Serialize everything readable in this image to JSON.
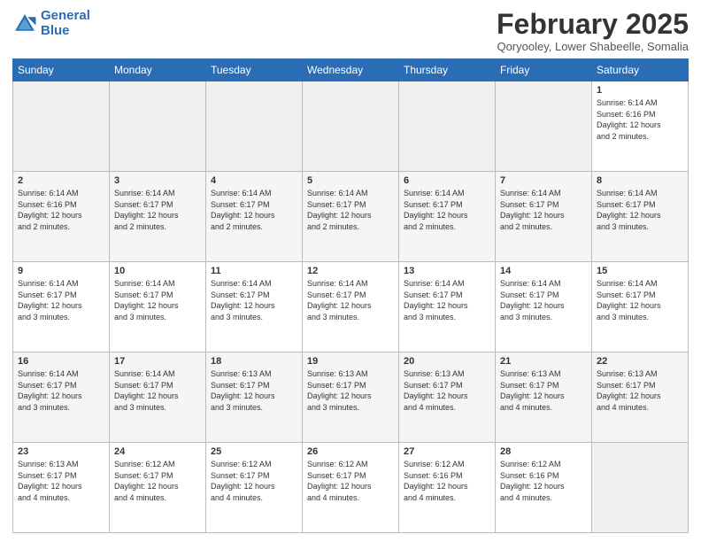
{
  "logo": {
    "line1": "General",
    "line2": "Blue"
  },
  "title": "February 2025",
  "subtitle": "Qoryooley, Lower Shabeelle, Somalia",
  "days_of_week": [
    "Sunday",
    "Monday",
    "Tuesday",
    "Wednesday",
    "Thursday",
    "Friday",
    "Saturday"
  ],
  "weeks": [
    [
      {
        "day": "",
        "info": ""
      },
      {
        "day": "",
        "info": ""
      },
      {
        "day": "",
        "info": ""
      },
      {
        "day": "",
        "info": ""
      },
      {
        "day": "",
        "info": ""
      },
      {
        "day": "",
        "info": ""
      },
      {
        "day": "1",
        "info": "Sunrise: 6:14 AM\nSunset: 6:16 PM\nDaylight: 12 hours\nand 2 minutes."
      }
    ],
    [
      {
        "day": "2",
        "info": "Sunrise: 6:14 AM\nSunset: 6:16 PM\nDaylight: 12 hours\nand 2 minutes."
      },
      {
        "day": "3",
        "info": "Sunrise: 6:14 AM\nSunset: 6:17 PM\nDaylight: 12 hours\nand 2 minutes."
      },
      {
        "day": "4",
        "info": "Sunrise: 6:14 AM\nSunset: 6:17 PM\nDaylight: 12 hours\nand 2 minutes."
      },
      {
        "day": "5",
        "info": "Sunrise: 6:14 AM\nSunset: 6:17 PM\nDaylight: 12 hours\nand 2 minutes."
      },
      {
        "day": "6",
        "info": "Sunrise: 6:14 AM\nSunset: 6:17 PM\nDaylight: 12 hours\nand 2 minutes."
      },
      {
        "day": "7",
        "info": "Sunrise: 6:14 AM\nSunset: 6:17 PM\nDaylight: 12 hours\nand 2 minutes."
      },
      {
        "day": "8",
        "info": "Sunrise: 6:14 AM\nSunset: 6:17 PM\nDaylight: 12 hours\nand 3 minutes."
      }
    ],
    [
      {
        "day": "9",
        "info": "Sunrise: 6:14 AM\nSunset: 6:17 PM\nDaylight: 12 hours\nand 3 minutes."
      },
      {
        "day": "10",
        "info": "Sunrise: 6:14 AM\nSunset: 6:17 PM\nDaylight: 12 hours\nand 3 minutes."
      },
      {
        "day": "11",
        "info": "Sunrise: 6:14 AM\nSunset: 6:17 PM\nDaylight: 12 hours\nand 3 minutes."
      },
      {
        "day": "12",
        "info": "Sunrise: 6:14 AM\nSunset: 6:17 PM\nDaylight: 12 hours\nand 3 minutes."
      },
      {
        "day": "13",
        "info": "Sunrise: 6:14 AM\nSunset: 6:17 PM\nDaylight: 12 hours\nand 3 minutes."
      },
      {
        "day": "14",
        "info": "Sunrise: 6:14 AM\nSunset: 6:17 PM\nDaylight: 12 hours\nand 3 minutes."
      },
      {
        "day": "15",
        "info": "Sunrise: 6:14 AM\nSunset: 6:17 PM\nDaylight: 12 hours\nand 3 minutes."
      }
    ],
    [
      {
        "day": "16",
        "info": "Sunrise: 6:14 AM\nSunset: 6:17 PM\nDaylight: 12 hours\nand 3 minutes."
      },
      {
        "day": "17",
        "info": "Sunrise: 6:14 AM\nSunset: 6:17 PM\nDaylight: 12 hours\nand 3 minutes."
      },
      {
        "day": "18",
        "info": "Sunrise: 6:13 AM\nSunset: 6:17 PM\nDaylight: 12 hours\nand 3 minutes."
      },
      {
        "day": "19",
        "info": "Sunrise: 6:13 AM\nSunset: 6:17 PM\nDaylight: 12 hours\nand 3 minutes."
      },
      {
        "day": "20",
        "info": "Sunrise: 6:13 AM\nSunset: 6:17 PM\nDaylight: 12 hours\nand 4 minutes."
      },
      {
        "day": "21",
        "info": "Sunrise: 6:13 AM\nSunset: 6:17 PM\nDaylight: 12 hours\nand 4 minutes."
      },
      {
        "day": "22",
        "info": "Sunrise: 6:13 AM\nSunset: 6:17 PM\nDaylight: 12 hours\nand 4 minutes."
      }
    ],
    [
      {
        "day": "23",
        "info": "Sunrise: 6:13 AM\nSunset: 6:17 PM\nDaylight: 12 hours\nand 4 minutes."
      },
      {
        "day": "24",
        "info": "Sunrise: 6:12 AM\nSunset: 6:17 PM\nDaylight: 12 hours\nand 4 minutes."
      },
      {
        "day": "25",
        "info": "Sunrise: 6:12 AM\nSunset: 6:17 PM\nDaylight: 12 hours\nand 4 minutes."
      },
      {
        "day": "26",
        "info": "Sunrise: 6:12 AM\nSunset: 6:17 PM\nDaylight: 12 hours\nand 4 minutes."
      },
      {
        "day": "27",
        "info": "Sunrise: 6:12 AM\nSunset: 6:16 PM\nDaylight: 12 hours\nand 4 minutes."
      },
      {
        "day": "28",
        "info": "Sunrise: 6:12 AM\nSunset: 6:16 PM\nDaylight: 12 hours\nand 4 minutes."
      },
      {
        "day": "",
        "info": ""
      }
    ]
  ]
}
